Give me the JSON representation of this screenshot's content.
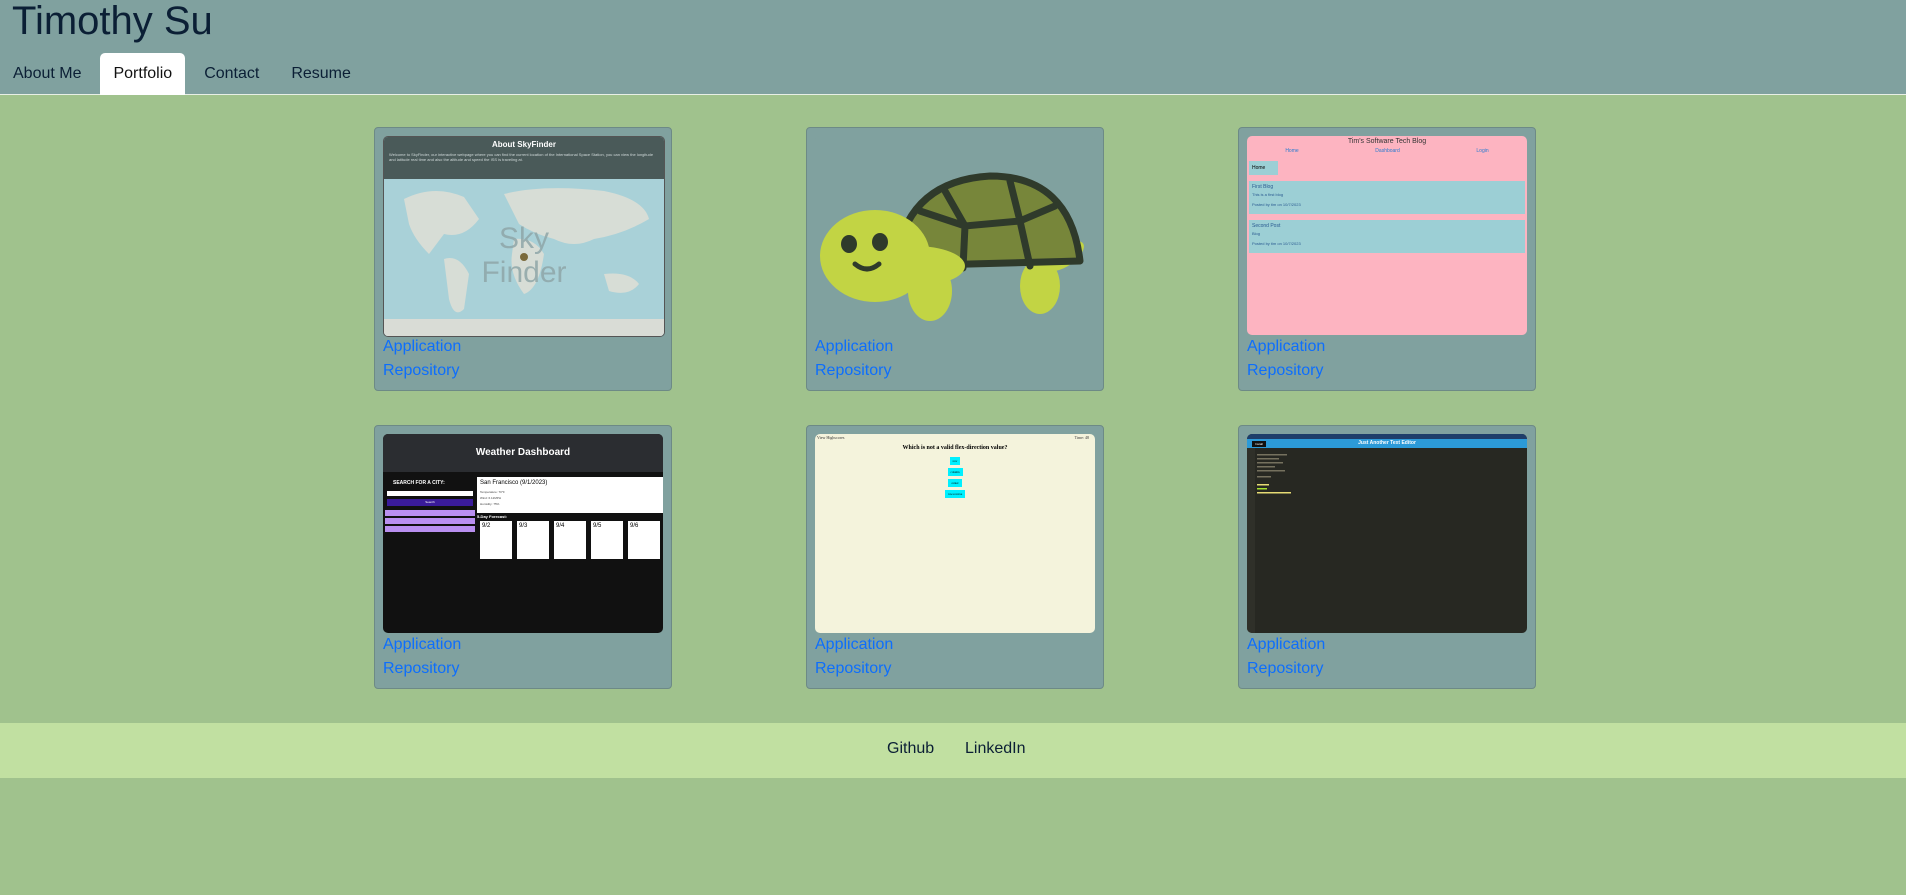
{
  "header": {
    "title": "Timothy Su",
    "nav": [
      {
        "label": "About Me",
        "active": false
      },
      {
        "label": "Portfolio",
        "active": true
      },
      {
        "label": "Contact",
        "active": false
      },
      {
        "label": "Resume",
        "active": false
      }
    ]
  },
  "projects": [
    {
      "thumbnail": "skyfinder-screenshot",
      "application_label": "Application",
      "repository_label": "Repository",
      "shot": {
        "heading": "About SkyFinder",
        "blurb": "Welcome to SkyFinder, our interactive webpage where you can find the current location of the International Space Station, you can view the longitude and latitude real time and also the altitude and speed the ISS is traveling at.",
        "overlay": [
          "Sky",
          "Finder"
        ]
      }
    },
    {
      "thumbnail": "turtle-image",
      "application_label": "Application",
      "repository_label": "Repository"
    },
    {
      "thumbnail": "tech-blog-screenshot",
      "application_label": "Application",
      "repository_label": "Repository",
      "shot": {
        "title": "Tim's Software Tech Blog",
        "nav": [
          "Home",
          "Dashboard",
          "Login"
        ],
        "home_button": "Home",
        "posts": [
          {
            "title": "First Blog",
            "body": "This is a first blog",
            "meta": "Posted by tim on 10/7/2023"
          },
          {
            "title": "Second Post",
            "body": "Blog",
            "meta": "Posted by tim on 10/7/2023"
          }
        ]
      }
    },
    {
      "thumbnail": "weather-dashboard-screenshot",
      "application_label": "Application",
      "repository_label": "Repository",
      "shot": {
        "title": "Weather Dashboard",
        "search_label": "SEARCH FOR A CITY:",
        "search_button": "Search",
        "current_city": "San Francisco (9/1/2023)",
        "current_lines": [
          "Temperature: 70°F",
          "Wind: 6.12MPH",
          "Humidity: 75%"
        ],
        "forecast_heading": "5-Day Forecast:",
        "forecast": [
          "9/2",
          "9/3",
          "9/4",
          "9/5",
          "9/6"
        ]
      }
    },
    {
      "thumbnail": "quiz-screenshot",
      "application_label": "Application",
      "repository_label": "Repository",
      "shot": {
        "left": "View Highscores",
        "right": "Time: 48",
        "question": "Which is not a valid flex-direction value?",
        "answers": [
          "row",
          "column",
          "center",
          "row-reverse"
        ]
      }
    },
    {
      "thumbnail": "text-editor-screenshot",
      "application_label": "Application",
      "repository_label": "Repository",
      "shot": {
        "title": "Just Another Text Editor",
        "install": "Install"
      }
    }
  ],
  "footer": {
    "links": [
      "Github",
      "LinkedIn"
    ]
  },
  "colors": {
    "page_bg": "#a0c28d",
    "header_bg": "#80a19f",
    "card_bg": "#80a19f",
    "footer_bg": "#c1e0a1",
    "link": "#0d6efd",
    "text": "#0b1f35"
  }
}
